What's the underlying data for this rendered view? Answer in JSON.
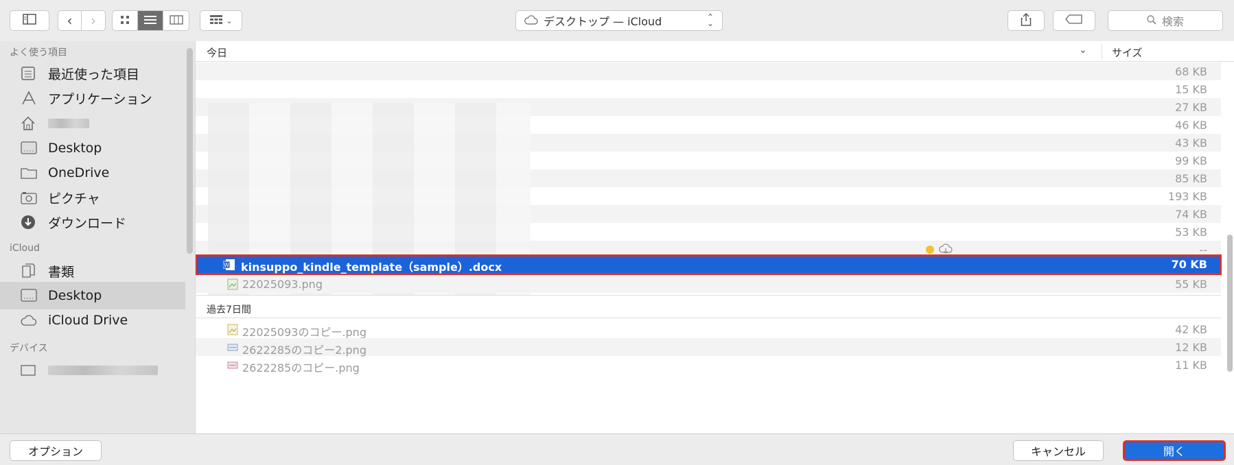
{
  "toolbar": {
    "location_label": "デスクトップ — iCloud",
    "search_placeholder": "検索"
  },
  "sidebar": {
    "sections": {
      "favorites": "よく使う項目",
      "icloud": "iCloud",
      "devices": "デバイス"
    },
    "favorites": [
      {
        "label": "最近使った項目",
        "icon": "recents-icon"
      },
      {
        "label": "アプリケーション",
        "icon": "applications-icon"
      },
      {
        "label": "",
        "icon": "home-icon"
      },
      {
        "label": "Desktop",
        "icon": "desktop-folder-icon"
      },
      {
        "label": "OneDrive",
        "icon": "folder-icon"
      },
      {
        "label": "ピクチャ",
        "icon": "camera-icon"
      },
      {
        "label": "ダウンロード",
        "icon": "download-icon"
      }
    ],
    "icloud_items": [
      {
        "label": "書類",
        "icon": "documents-icon"
      },
      {
        "label": "Desktop",
        "icon": "desktop-folder-icon"
      },
      {
        "label": "iCloud Drive",
        "icon": "cloud-icon"
      }
    ]
  },
  "list": {
    "header": {
      "group": "今日",
      "size_column": "サイズ"
    },
    "today_sizes": [
      "68 KB",
      "15 KB",
      "27 KB",
      "46 KB",
      "43 KB",
      "99 KB",
      "85 KB",
      "193 KB",
      "74 KB",
      "53 KB",
      "--"
    ],
    "selected_file": {
      "name": "kinsuppo_kindle_template（sample）.docx",
      "size": "70 KB"
    },
    "after_selected": {
      "name": "22025093.png",
      "size": "55 KB"
    },
    "group2": "過去7日間",
    "past_week": [
      {
        "name": "22025093のコピー.png",
        "size": "42 KB"
      },
      {
        "name": "2622285のコピー2.png",
        "size": "12 KB"
      },
      {
        "name": "2622285のコピー.png",
        "size": "11 KB"
      }
    ]
  },
  "buttons": {
    "options": "オプション",
    "cancel": "キャンセル",
    "open": "開く"
  },
  "colors": {
    "selection": "#1b63d9",
    "highlight_outline": "#d9302b",
    "primary_button": "#1b6fe0"
  }
}
